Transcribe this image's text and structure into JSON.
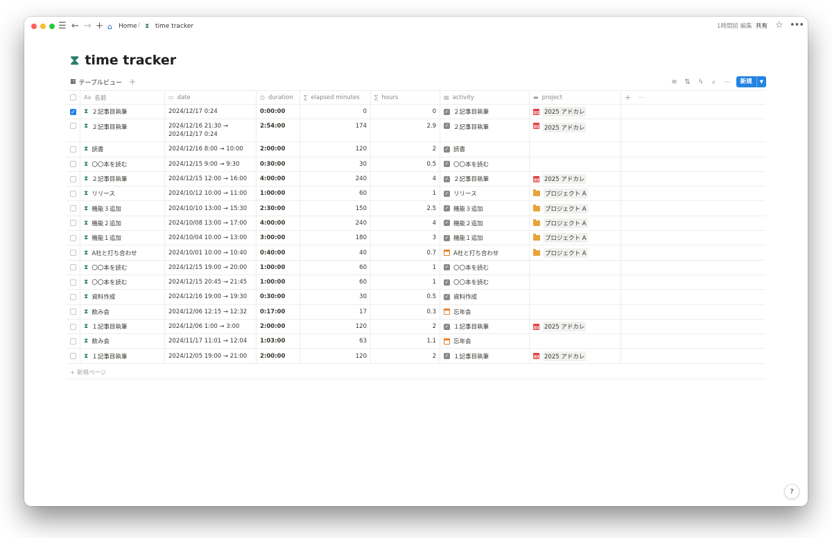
{
  "breadcrumb": {
    "home": "Home",
    "page": "time tracker"
  },
  "topbar": {
    "edited": "1時間前 編集",
    "share": "共有"
  },
  "page": {
    "title": "time tracker",
    "icon": "hourglass-icon"
  },
  "view": {
    "tab_label": "テーブルビュー",
    "new_button": "新規"
  },
  "columns": {
    "name": "名前",
    "date": "date",
    "duration": "duration",
    "elapsed": "elapsed minutes",
    "hours": "hours",
    "activity": "activity",
    "project": "project"
  },
  "rows": [
    {
      "checked": true,
      "name": "２記事目執筆",
      "date": "2024/12/17 0:24",
      "duration": "0:00:00",
      "minutes": "0",
      "hours": "0",
      "activity": "２記事目執筆",
      "act_icon": "check",
      "project": "2025 アドカレ",
      "proj_icon": "calendar-red"
    },
    {
      "checked": false,
      "name": "２記事目執筆",
      "date": "2024/12/16 21:30 → 2024/12/17 0:24",
      "duration": "2:54:00",
      "minutes": "174",
      "hours": "2.9",
      "activity": "２記事目執筆",
      "act_icon": "check",
      "project": "2025 アドカレ",
      "proj_icon": "calendar-red"
    },
    {
      "checked": false,
      "name": "読書",
      "date": "2024/12/16 8:00 → 10:00",
      "duration": "2:00:00",
      "minutes": "120",
      "hours": "2",
      "activity": "読書",
      "act_icon": "check",
      "project": "",
      "proj_icon": ""
    },
    {
      "checked": false,
      "name": "〇〇本を読む",
      "date": "2024/12/15 9:00 → 9:30",
      "duration": "0:30:00",
      "minutes": "30",
      "hours": "0.5",
      "activity": "〇〇本を読む",
      "act_icon": "check",
      "project": "",
      "proj_icon": ""
    },
    {
      "checked": false,
      "name": "２記事目執筆",
      "date": "2024/12/15 12:00 → 16:00",
      "duration": "4:00:00",
      "minutes": "240",
      "hours": "4",
      "activity": "２記事目執筆",
      "act_icon": "check",
      "project": "2025 アドカレ",
      "proj_icon": "calendar-red"
    },
    {
      "checked": false,
      "name": "リリース",
      "date": "2024/10/12 10:00 → 11:00",
      "duration": "1:00:00",
      "minutes": "60",
      "hours": "1",
      "activity": "リリース",
      "act_icon": "check",
      "project": "プロジェクト A",
      "proj_icon": "folder"
    },
    {
      "checked": false,
      "name": "機能３追加",
      "date": "2024/10/10 13:00 → 15:30",
      "duration": "2:30:00",
      "minutes": "150",
      "hours": "2.5",
      "activity": "機能３追加",
      "act_icon": "check",
      "project": "プロジェクト A",
      "proj_icon": "folder"
    },
    {
      "checked": false,
      "name": "機能２追加",
      "date": "2024/10/08 13:00 → 17:00",
      "duration": "4:00:00",
      "minutes": "240",
      "hours": "4",
      "activity": "機能２追加",
      "act_icon": "check",
      "project": "プロジェクト A",
      "proj_icon": "folder"
    },
    {
      "checked": false,
      "name": "機能１追加",
      "date": "2024/10/04 10:00 → 13:00",
      "duration": "3:00:00",
      "minutes": "180",
      "hours": "3",
      "activity": "機能１追加",
      "act_icon": "check",
      "project": "プロジェクト A",
      "proj_icon": "folder"
    },
    {
      "checked": false,
      "name": "A社と打ち合わせ",
      "date": "2024/10/01 10:00 → 10:40",
      "duration": "0:40:00",
      "minutes": "40",
      "hours": "0.7",
      "activity": "A社と打ち合わせ",
      "act_icon": "calendar",
      "project": "プロジェクト A",
      "proj_icon": "folder"
    },
    {
      "checked": false,
      "name": "〇〇本を読む",
      "date": "2024/12/15 19:00 → 20:00",
      "duration": "1:00:00",
      "minutes": "60",
      "hours": "1",
      "activity": "〇〇本を読む",
      "act_icon": "check",
      "project": "",
      "proj_icon": ""
    },
    {
      "checked": false,
      "name": "〇〇本を読む",
      "date": "2024/12/15 20:45 → 21:45",
      "duration": "1:00:00",
      "minutes": "60",
      "hours": "1",
      "activity": "〇〇本を読む",
      "act_icon": "check",
      "project": "",
      "proj_icon": ""
    },
    {
      "checked": false,
      "name": "資料作成",
      "date": "2024/12/16 19:00 → 19:30",
      "duration": "0:30:00",
      "minutes": "30",
      "hours": "0.5",
      "activity": "資料作成",
      "act_icon": "check",
      "project": "",
      "proj_icon": ""
    },
    {
      "checked": false,
      "name": "飲み会",
      "date": "2024/12/06 12:15 → 12:32",
      "duration": "0:17:00",
      "minutes": "17",
      "hours": "0.3",
      "activity": "忘年会",
      "act_icon": "calendar",
      "project": "",
      "proj_icon": ""
    },
    {
      "checked": false,
      "name": "１記事目執筆",
      "date": "2024/12/06 1:00 → 3:00",
      "duration": "2:00:00",
      "minutes": "120",
      "hours": "2",
      "activity": "１記事目執筆",
      "act_icon": "check",
      "project": "2025 アドカレ",
      "proj_icon": "calendar-red"
    },
    {
      "checked": false,
      "name": "飲み会",
      "date": "2024/11/17 11:01 → 12:04",
      "duration": "1:03:00",
      "minutes": "63",
      "hours": "1.1",
      "activity": "忘年会",
      "act_icon": "calendar",
      "project": "",
      "proj_icon": ""
    },
    {
      "checked": false,
      "name": "１記事目執筆",
      "date": "2024/12/05 19:00 → 21:00",
      "duration": "2:00:00",
      "minutes": "120",
      "hours": "2",
      "activity": "１記事目執筆",
      "act_icon": "check",
      "project": "2025 アドカレ",
      "proj_icon": "calendar-red"
    }
  ],
  "table_footer": {
    "new_page": "新規ページ"
  }
}
